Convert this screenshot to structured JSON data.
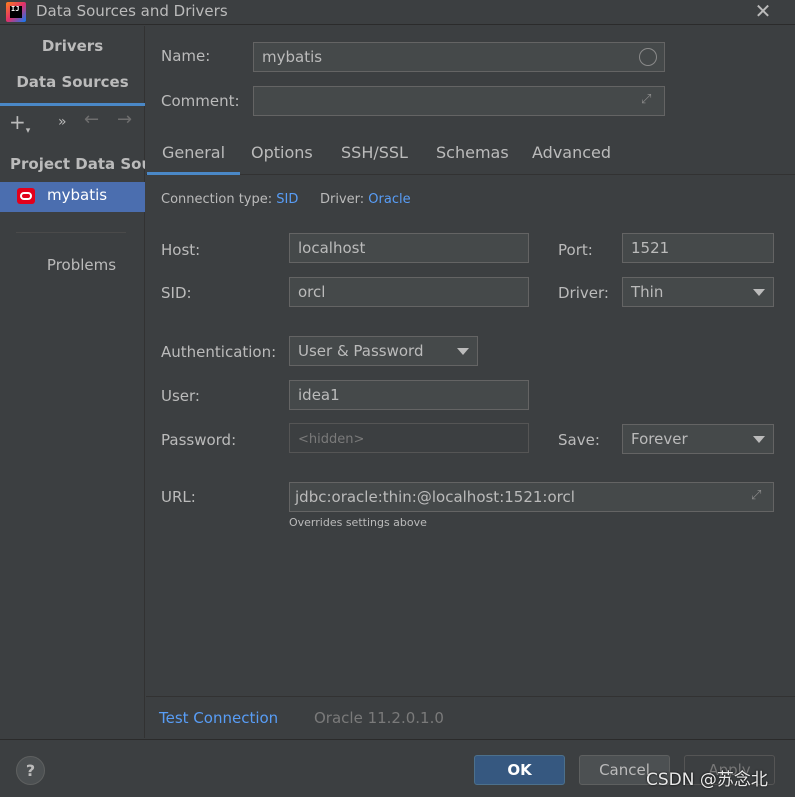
{
  "window": {
    "title": "Data Sources and Drivers",
    "app_icon_text": "IJ"
  },
  "sidebar": {
    "drivers_label": "Drivers",
    "data_sources_label": "Data Sources",
    "section_header": "Project Data Sources",
    "items": [
      {
        "label": "mybatis",
        "selected": true
      }
    ],
    "problems_label": "Problems"
  },
  "form": {
    "name_label": "Name:",
    "name_value": "mybatis",
    "comment_label": "Comment:",
    "comment_value": ""
  },
  "tabs": [
    {
      "label": "General",
      "active": true
    },
    {
      "label": "Options",
      "active": false
    },
    {
      "label": "SSH/SSL",
      "active": false
    },
    {
      "label": "Schemas",
      "active": false
    },
    {
      "label": "Advanced",
      "active": false
    }
  ],
  "connection": {
    "type_label": "Connection type:",
    "type_value": "SID",
    "driver_label": "Driver:",
    "driver_value": "Oracle"
  },
  "general": {
    "host_label": "Host:",
    "host_value": "localhost",
    "port_label": "Port:",
    "port_value": "1521",
    "sid_label": "SID:",
    "sid_value": "orcl",
    "driver_label": "Driver:",
    "driver_value": "Thin",
    "auth_label": "Authentication:",
    "auth_value": "User & Password",
    "user_label": "User:",
    "user_value": "idea1",
    "password_label": "Password:",
    "password_placeholder": "<hidden>",
    "save_label": "Save:",
    "save_value": "Forever",
    "url_label": "URL:",
    "url_value": "jdbc:oracle:thin:@localhost:1521:orcl",
    "url_hint": "Overrides settings above"
  },
  "bottom": {
    "test_connection": "Test Connection",
    "version": "Oracle 11.2.0.1.0"
  },
  "footer": {
    "help_label": "?",
    "ok_label": "OK",
    "cancel_label": "Cancel",
    "apply_label": "Apply",
    "watermark": "CSDN @苏念北"
  },
  "colors": {
    "background": "#3c3f41",
    "selection": "#4b6eaf",
    "accent": "#4a88c7",
    "link": "#589df6",
    "primary_button": "#365880"
  }
}
